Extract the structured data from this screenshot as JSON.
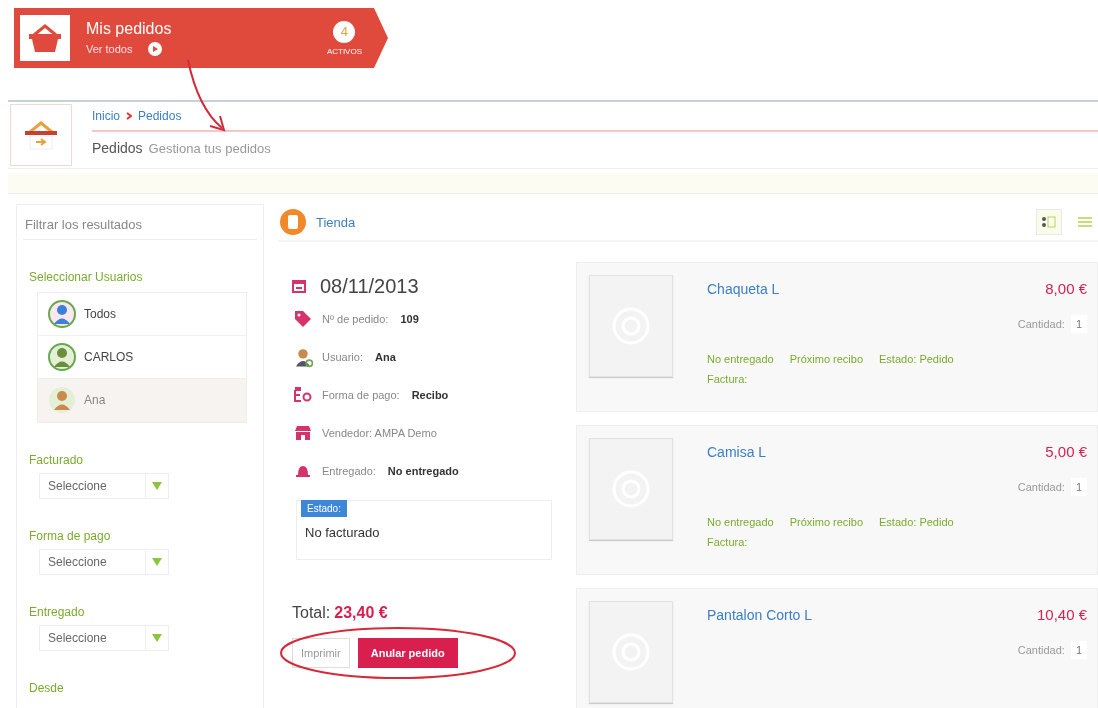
{
  "banner": {
    "title": "Mis pedidos",
    "link": "Ver todos",
    "count": "4",
    "count_label": "ACTIVOS"
  },
  "breadcrumb": [
    {
      "label": "Inicio"
    },
    {
      "label": "Pedidos"
    }
  ],
  "page": {
    "title": "Pedidos",
    "subtitle": "Gestiona tus pedidos"
  },
  "sidebar": {
    "filter_placeholder": "Filtrar los resultados",
    "users_heading": "Seleccionar Usuarios",
    "users": [
      {
        "name": "Todos",
        "kind": "group",
        "selected": false
      },
      {
        "name": "CARLOS",
        "kind": "boy",
        "selected": false
      },
      {
        "name": "Ana",
        "kind": "girl",
        "selected": true
      }
    ],
    "filters": [
      {
        "label": "Facturado",
        "value": "Seleccione"
      },
      {
        "label": "Forma de pago",
        "value": "Seleccione"
      },
      {
        "label": "Entregado",
        "value": "Seleccione"
      }
    ],
    "next_heading": "Desde"
  },
  "shop": {
    "name": "Tienda"
  },
  "view_toggle": [
    {
      "kind": "grid",
      "selected": true
    },
    {
      "kind": "list",
      "selected": false
    }
  ],
  "order": {
    "date": "08/11/2013",
    "fields": [
      {
        "kind": "number",
        "label": "Nº de pedido:",
        "value": "109"
      },
      {
        "kind": "user",
        "label": "Usuario:",
        "value": "Ana"
      },
      {
        "kind": "payment",
        "label": "Forma de pago:",
        "value": "Recibo"
      },
      {
        "kind": "seller",
        "label": "Vendedor: AMPA Demo"
      },
      {
        "kind": "delivery",
        "label": "Entregado:",
        "value": "No entregado"
      }
    ],
    "status_label": "Estado:",
    "status": "No facturado",
    "total_label": "Total:",
    "total": "23,40 €",
    "buttons": [
      {
        "label": "Imprimir",
        "kind": "secondary"
      },
      {
        "label": "Anular pedido",
        "kind": "primary"
      }
    ]
  },
  "items": [
    {
      "name": "Chaqueta L",
      "price": "8,00 €",
      "quantity_label": "Cantidad:",
      "quantity": "1",
      "tags": [
        "No entregado",
        "Próximo recibo",
        "Estado: Pedido"
      ],
      "invoice": "Factura:"
    },
    {
      "name": "Camisa L",
      "price": "5,00 €",
      "quantity_label": "Cantidad:",
      "quantity": "1",
      "tags": [
        "No entregado",
        "Próximo recibo",
        "Estado: Pedido"
      ],
      "invoice": "Factura:"
    },
    {
      "name": "Pantalon Corto L",
      "price": "10,40 €",
      "quantity_label": "Cantidad:",
      "quantity": "1"
    }
  ]
}
